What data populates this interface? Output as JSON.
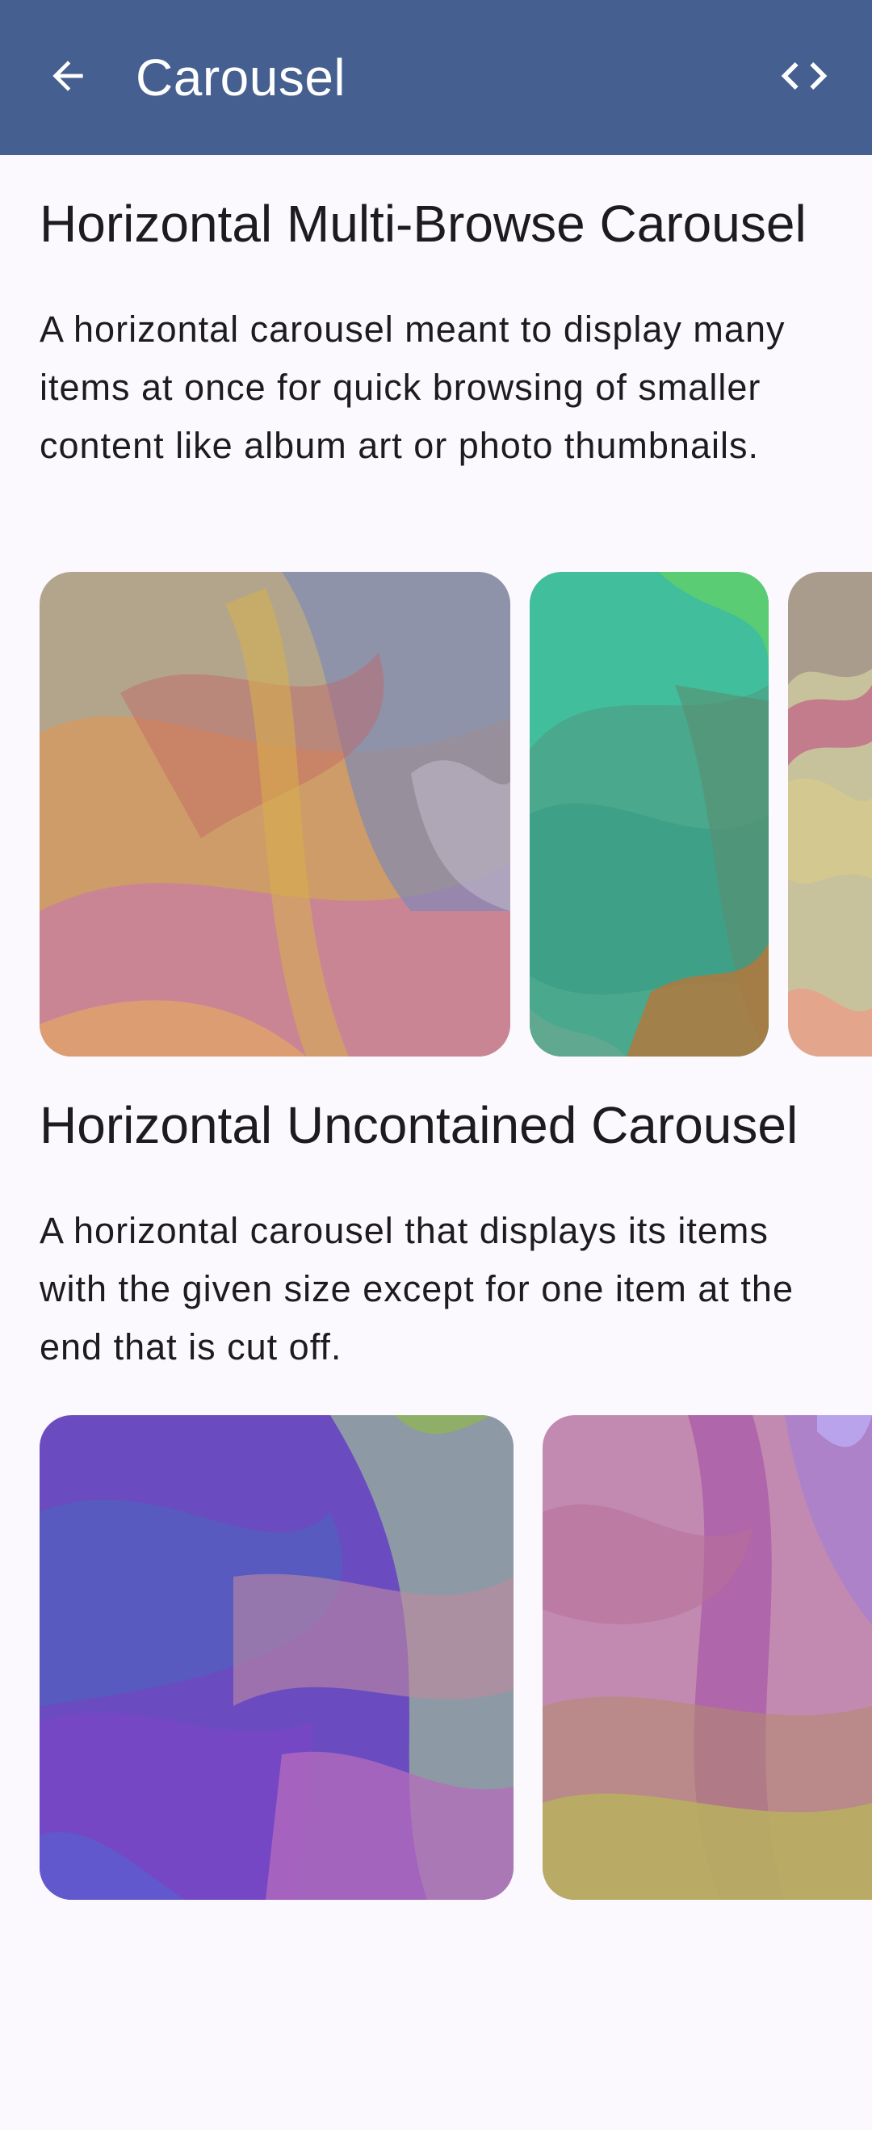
{
  "app_bar": {
    "title": "Carousel",
    "background": "#455f90",
    "back_icon": "arrow-back-icon",
    "code_icon": "code-icon"
  },
  "sections": [
    {
      "title": "Horizontal Multi-Browse Carousel",
      "description": "A horizontal carousel meant to display many items at once for quick browsing of smaller content like album art or photo thumbnails.",
      "items": [
        {
          "name": "carousel-item-1",
          "palette": [
            "#b59a87",
            "#d99a5f",
            "#c47ab0",
            "#7a86b8"
          ]
        },
        {
          "name": "carousel-item-2",
          "palette": [
            "#3fb69a",
            "#4fb07a",
            "#2fc4a8",
            "#b5763a"
          ]
        },
        {
          "name": "carousel-item-3",
          "palette": [
            "#c5bfa0",
            "#d8c98e",
            "#c46a8a",
            "#e8a488"
          ]
        }
      ]
    },
    {
      "title": "Horizontal Uncontained Carousel",
      "description": "A horizontal carousel that displays its items with the given size except for one item at the end that is cut off.",
      "items": [
        {
          "name": "carousel-item-1",
          "palette": [
            "#6a3fc0",
            "#4f5ec2",
            "#b36bb8",
            "#9ab0a0"
          ]
        },
        {
          "name": "carousel-item-2",
          "palette": [
            "#c588b0",
            "#b05aa8",
            "#b8a85e",
            "#a07ac8"
          ]
        }
      ]
    }
  ]
}
